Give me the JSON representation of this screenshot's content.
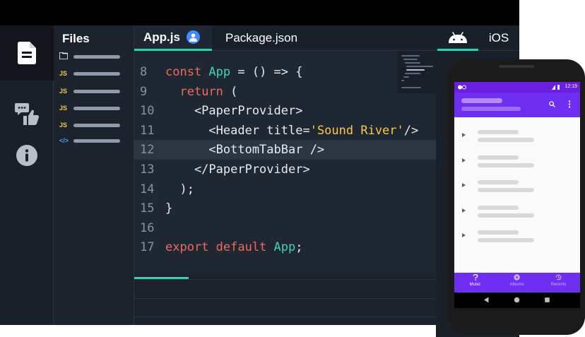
{
  "editor": {
    "files_title": "Files",
    "files": [
      {
        "type": "folder",
        "badge": ""
      },
      {
        "type": "js",
        "badge": "JS"
      },
      {
        "type": "js",
        "badge": "JS"
      },
      {
        "type": "js",
        "badge": "JS"
      },
      {
        "type": "js",
        "badge": "JS"
      },
      {
        "type": "xml",
        "badge": "</>"
      }
    ],
    "tabs": {
      "active": "App.js",
      "other": "Package.json",
      "platform_ios": "iOS"
    },
    "code_lines": [
      {
        "num": "8",
        "tokens": [
          {
            "t": "const ",
            "c": "kw"
          },
          {
            "t": "App",
            "c": "id"
          },
          {
            "t": " = () => {",
            "c": ""
          }
        ]
      },
      {
        "num": "9",
        "tokens": [
          {
            "t": "  ",
            "c": ""
          },
          {
            "t": "return",
            "c": "kw"
          },
          {
            "t": " (",
            "c": ""
          }
        ]
      },
      {
        "num": "10",
        "tokens": [
          {
            "t": "    <PaperProvider>",
            "c": ""
          }
        ]
      },
      {
        "num": "11",
        "tokens": [
          {
            "t": "      <Header title=",
            "c": ""
          },
          {
            "t": "'Sound River'",
            "c": "str"
          },
          {
            "t": "/>",
            "c": ""
          }
        ]
      },
      {
        "num": "12",
        "tokens": [
          {
            "t": "      <BottomTabBar />",
            "c": ""
          }
        ],
        "highlight": true
      },
      {
        "num": "13",
        "tokens": [
          {
            "t": "    </PaperProvider>",
            "c": ""
          }
        ]
      },
      {
        "num": "14",
        "tokens": [
          {
            "t": "  );",
            "c": ""
          }
        ]
      },
      {
        "num": "15",
        "tokens": [
          {
            "t": "}",
            "c": ""
          }
        ]
      },
      {
        "num": "16",
        "tokens": []
      },
      {
        "num": "17",
        "tokens": [
          {
            "t": "export default ",
            "c": "kw"
          },
          {
            "t": "App",
            "c": "id"
          },
          {
            "t": ";",
            "c": ""
          }
        ]
      }
    ],
    "progress_fraction": 0.18
  },
  "phone": {
    "status_time": "12:19",
    "bottom_nav": {
      "music": "Music",
      "albums": "Albums",
      "recents": "Recents"
    },
    "list_count": 5
  },
  "colors": {
    "accent": "#2fd1b5",
    "keyword": "#f0695c",
    "identifier": "#3ed6b3",
    "string": "#f7c948",
    "app_primary": "#6f2ef2"
  },
  "icons": {
    "activity": [
      "file-icon",
      "snack-feedback-icon",
      "info-icon"
    ],
    "platform": [
      "android-icon",
      "ios-label"
    ]
  }
}
